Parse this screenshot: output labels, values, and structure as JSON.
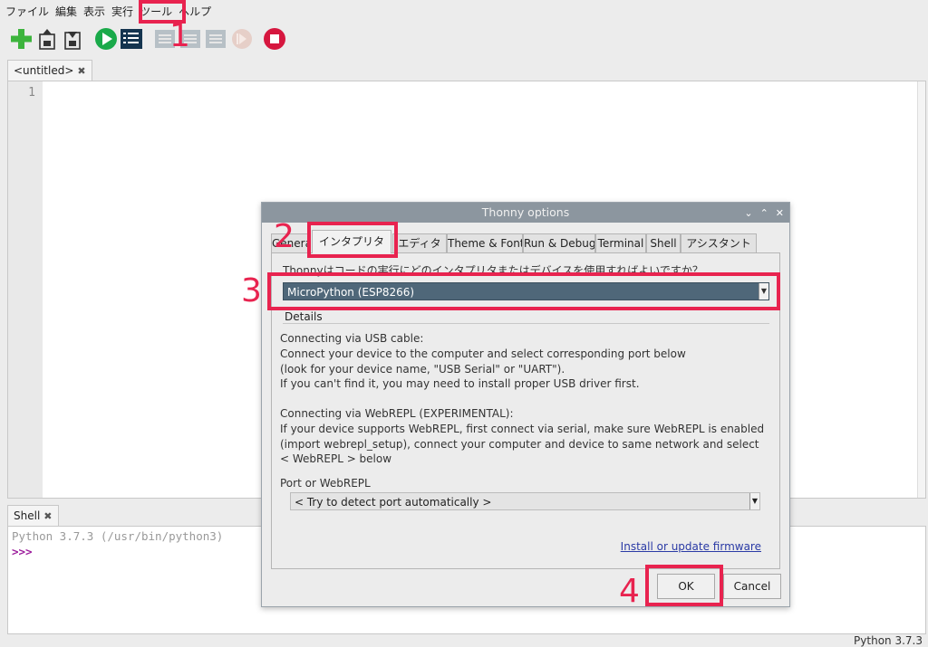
{
  "menu": [
    "ファイル",
    "編集",
    "表示",
    "実行",
    "ツール",
    "ヘルプ"
  ],
  "toolbar": [
    "new-icon",
    "open-icon",
    "save-icon",
    "run-icon",
    "debug-icon",
    "step-over-icon",
    "step-into-icon",
    "step-out-icon",
    "resume-icon",
    "stop-icon"
  ],
  "editor": {
    "tab": "<untitled>",
    "line": "1"
  },
  "shell": {
    "tab": "Shell",
    "line1": "Python 3.7.3 (/usr/bin/python3)",
    "prompt": ">>>"
  },
  "status": "Python 3.7.3",
  "dialog": {
    "title": "Thonny options",
    "tabs": [
      "General",
      "インタプリタ",
      "エディタ",
      "Theme & Font",
      "Run & Debug",
      "Terminal",
      "Shell",
      "アシスタント"
    ],
    "question": "Thonnyはコードの実行にどのインタプリタまたはデバイスを使用すればよいですか？",
    "interpreter": "MicroPython (ESP8266)",
    "details_label": "Details",
    "details": [
      "Connecting via USB cable:",
      "Connect your device to the computer and select corresponding port below",
      "(look for your device name, \"USB Serial\" or \"UART\").",
      "If you can't find it, you may need to install proper USB driver first.",
      "Connecting via WebREPL (EXPERIMENTAL):",
      "If your device supports WebREPL, first connect via serial, make sure WebREPL is enabled",
      "(import webrepl_setup), connect your computer and device to same network and select",
      "< WebREPL > below"
    ],
    "port_label": "Port or WebREPL",
    "port_value": "< Try to detect port automatically >",
    "firmware_link": "Install or update firmware",
    "ok": "OK",
    "cancel": "Cancel"
  },
  "annotations": [
    "1",
    "2",
    "3",
    "4"
  ],
  "colors": {
    "highlight": "#e8234f",
    "selected": "#4f6779"
  }
}
